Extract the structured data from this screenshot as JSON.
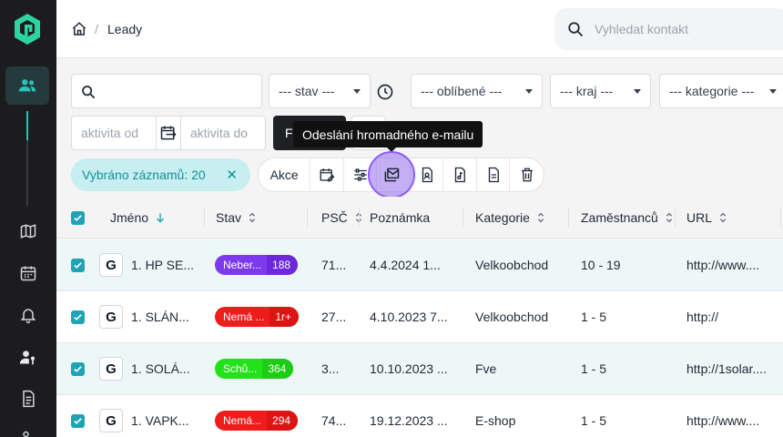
{
  "header": {
    "breadcrumb_current": "Leady",
    "breadcrumb_sep": "/",
    "search_placeholder": "Vyhledat kontakt"
  },
  "filters": {
    "stav": "--- stav ---",
    "oblibene": "--- oblíbené ---",
    "kraj": "--- kraj ---",
    "kategorie": "--- kategorie ---",
    "aktivita_od_placeholder": "aktivita od",
    "aktivita_do_placeholder": "aktivita do",
    "filter_button_initial": "F"
  },
  "tooltip": "Odeslání hromadného e-mailu",
  "selection": {
    "label": "Vybráno záznamů: 20",
    "clear": "✕"
  },
  "actions": {
    "akce_label": "Akce"
  },
  "table": {
    "columns": [
      "Jméno",
      "Stav",
      "PSČ",
      "Poznámka",
      "Kategorie",
      "Zaměstnanců",
      "URL"
    ],
    "rows": [
      {
        "name": "1. HP SE...",
        "status": "Neber...",
        "count": "188",
        "color": "#7c3aed",
        "color2": "#6d28d9",
        "psc": "71...",
        "note": "4.4.2024 1...",
        "category": "Velkoobchod",
        "employees": "10 - 19",
        "url": "http://www...."
      },
      {
        "name": "1. SLÁN...",
        "status": "Nemá ...",
        "count": "1r+",
        "color": "#ef1c1c",
        "color2": "#dc1414",
        "psc": "27...",
        "note": "4.10.2023 7...",
        "category": "Velkoobchod",
        "employees": "1 - 5",
        "url": "http://"
      },
      {
        "name": "1. SOLÁ...",
        "status": "Schů...",
        "count": "364",
        "color": "#22e21a",
        "color2": "#1ccd14",
        "psc": "3...",
        "note": "10.10.2023 ...",
        "category": "Fve",
        "employees": "1 - 5",
        "url": "http://1solar...."
      },
      {
        "name": "1. VAPK...",
        "status": "Nemá...",
        "count": "294",
        "color": "#ef1c1c",
        "color2": "#dc1414",
        "psc": "74...",
        "note": "19.12.2023 ...",
        "category": "E-shop",
        "employees": "1 - 5",
        "url": "http://www...."
      }
    ]
  }
}
